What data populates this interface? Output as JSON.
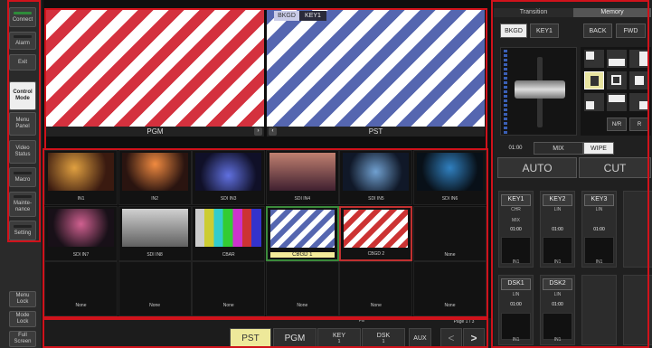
{
  "sidebar": {
    "connect": "Connect",
    "alarm": "Alarm",
    "exit": "Exit",
    "control_mode": "Control Mode",
    "menu_panel": "Menu Panel",
    "video_status": "Video Status",
    "macro": "Macro",
    "maintenance": "Mainte-nance",
    "setting": "Setting",
    "menu_lock": "Menu Lock",
    "mode_lock": "Mode Lock",
    "full_screen": "Full Screen"
  },
  "viewers": {
    "pgm_label": "PGM",
    "pst_label": "PST",
    "bkgd_tab": "BKGD",
    "key1_tab": "KEY1"
  },
  "sources": [
    {
      "name": "IN1"
    },
    {
      "name": "IN2"
    },
    {
      "name": "SDI IN3"
    },
    {
      "name": "SDI IN4"
    },
    {
      "name": "SDI IN5"
    },
    {
      "name": "SDI IN6"
    },
    {
      "name": "SDI IN7"
    },
    {
      "name": "SDI IN8"
    },
    {
      "name": "CBAR"
    },
    {
      "name": "CBGD 1"
    },
    {
      "name": "CBGD 2"
    },
    {
      "name": "None"
    },
    {
      "name": "None"
    },
    {
      "name": "None"
    },
    {
      "name": "None"
    },
    {
      "name": "None"
    },
    {
      "name": "None"
    },
    {
      "name": "None"
    }
  ],
  "bottom_bar": {
    "fill_label": "Fill",
    "pst": "PST",
    "pgm": "PGM",
    "key": "KEY",
    "key_num": "1",
    "dsk": "DSK",
    "dsk_num": "1",
    "aux": "AUX",
    "page": "Page 1 / 3",
    "prev": "<",
    "next": ">"
  },
  "right_panel": {
    "tab_transition": "Transition",
    "tab_memory": "Memory",
    "bkgd": "BKGD",
    "key1": "KEY1",
    "back": "BACK",
    "fwd": "FWD",
    "nr": "N/R",
    "r": "R",
    "time": "01:00",
    "mix": "MIX",
    "wipe": "WIPE",
    "auto": "AUTO",
    "cut": "CUT",
    "keys": [
      {
        "name": "KEY1",
        "mode": "CHR",
        "trans": "MIX",
        "time": "01:00",
        "src": "IN1"
      },
      {
        "name": "KEY2",
        "mode": "LIN",
        "trans": "",
        "time": "01:00",
        "src": "IN1"
      },
      {
        "name": "KEY3",
        "mode": "LIN",
        "trans": "",
        "time": "01:00",
        "src": "IN1"
      }
    ],
    "dsks": [
      {
        "name": "DSK1",
        "mode": "LIN",
        "time": "01:00",
        "src": "IN1"
      },
      {
        "name": "DSK2",
        "mode": "LIN",
        "time": "01:00",
        "src": "IN1"
      }
    ]
  },
  "colors": {
    "accent_red": "#d0121b",
    "selected_yellow": "#f4ec9a",
    "pgm_red": "#d4313e",
    "pst_blue": "#5566b0"
  }
}
